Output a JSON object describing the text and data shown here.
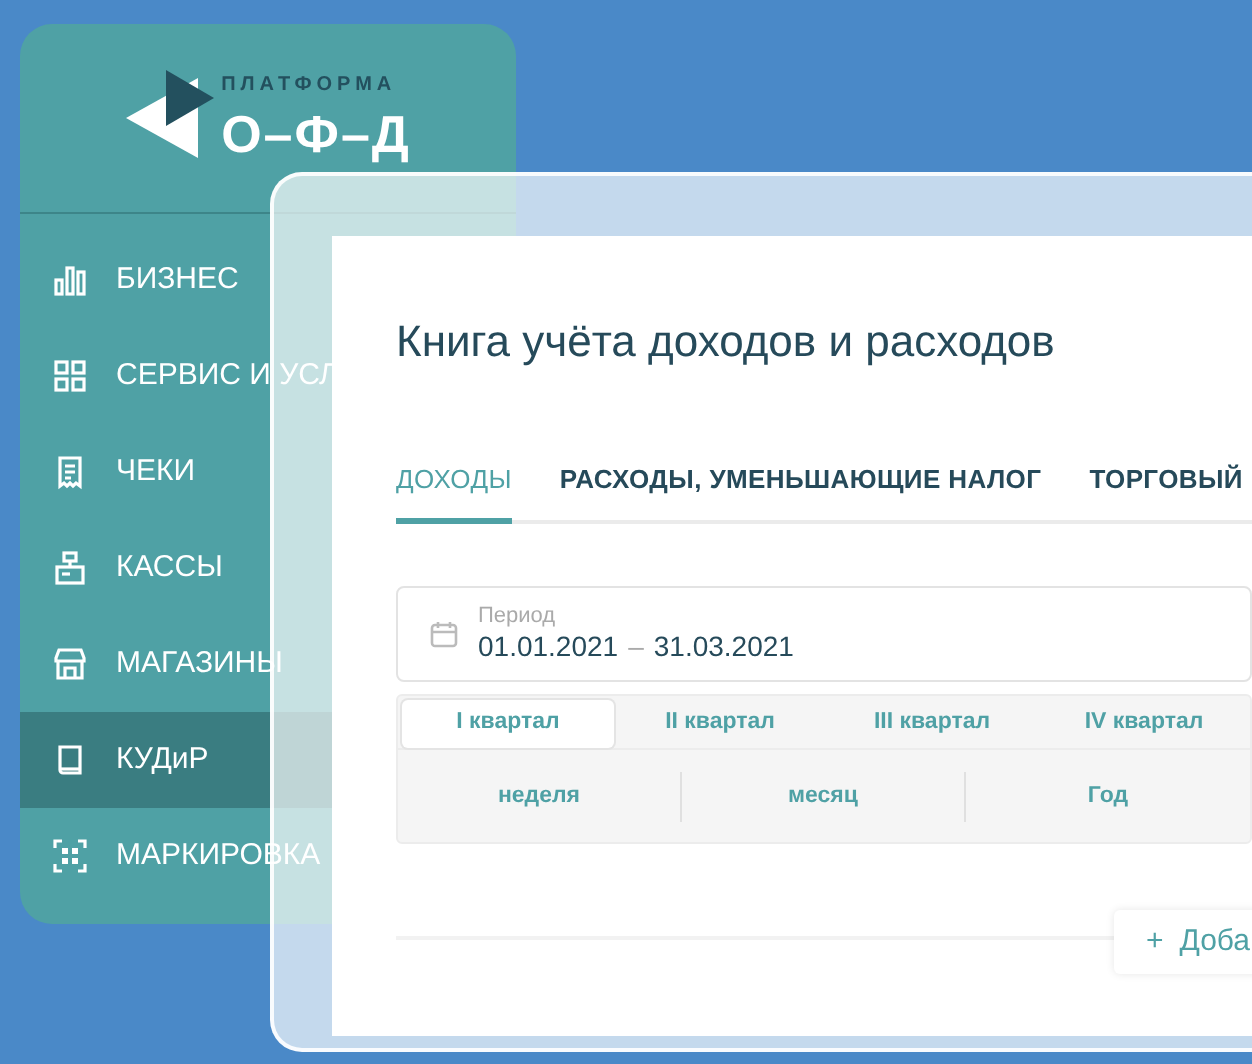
{
  "sidebar": {
    "logo": {
      "top": "ПЛАТФОРМА",
      "main": "О–Ф–Д"
    },
    "items": [
      {
        "label": "БИЗНЕС",
        "selected": false
      },
      {
        "label": "СЕРВИС И УСЛ",
        "selected": false
      },
      {
        "label": "ЧЕКИ",
        "selected": false
      },
      {
        "label": "КАССЫ",
        "selected": false
      },
      {
        "label": "МАГАЗИНЫ",
        "selected": false
      },
      {
        "label": "КУДиР",
        "selected": true
      },
      {
        "label": "МАРКИРОВКА",
        "selected": false
      }
    ]
  },
  "page": {
    "title": "Книга учёта доходов и расходов",
    "tabs": [
      {
        "label": "ДОХОДЫ",
        "selected": true
      },
      {
        "label": "РАСХОДЫ, УМЕНЬШАЮЩИЕ НАЛОГ",
        "selected": false
      },
      {
        "label": "ТОРГОВЫЙ",
        "selected": false
      }
    ],
    "period": {
      "label": "Период",
      "from": "01.01.2021",
      "separator": "–",
      "to": "31.03.2021"
    },
    "quarters": [
      {
        "label": "I квартал",
        "selected": true
      },
      {
        "label": "II квартал",
        "selected": false
      },
      {
        "label": "III квартал",
        "selected": false
      },
      {
        "label": "IV квартал",
        "selected": false
      }
    ],
    "ranges": [
      {
        "label": "неделя"
      },
      {
        "label": "месяц"
      },
      {
        "label": "Год"
      }
    ],
    "add_button": {
      "icon": "+",
      "label": "Доба"
    }
  }
}
